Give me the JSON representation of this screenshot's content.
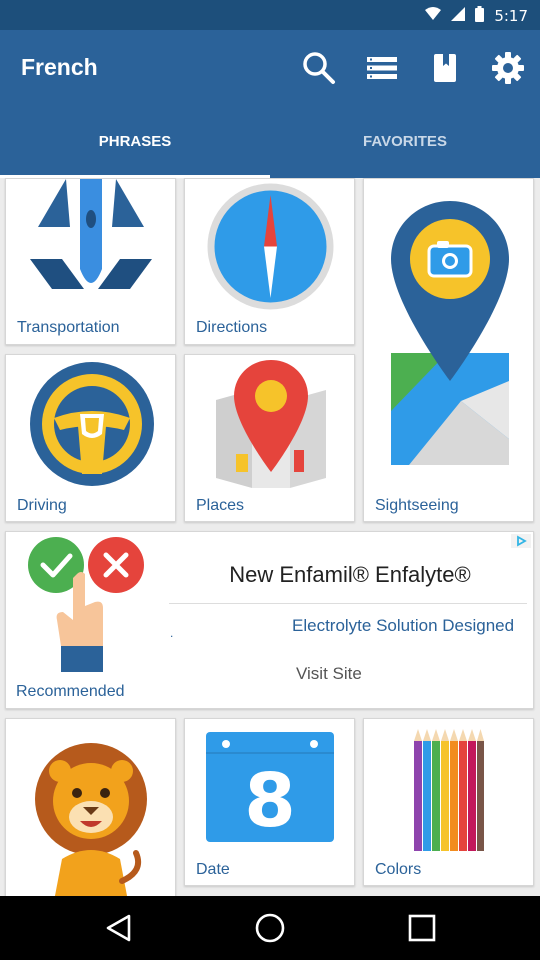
{
  "status_bar": {
    "time": "5:17"
  },
  "app_bar": {
    "title": "French",
    "tabs": [
      {
        "label": "PHRASES"
      },
      {
        "label": "FAVORITES"
      }
    ],
    "active_tab": "PHRASES"
  },
  "categories": [
    {
      "label": "Transportation",
      "icon": "airplane-icon"
    },
    {
      "label": "Directions",
      "icon": "compass-icon"
    },
    {
      "label": "Sightseeing",
      "icon": "map-pin-camera-icon"
    },
    {
      "label": "Driving",
      "icon": "steering-wheel-icon"
    },
    {
      "label": "Places",
      "icon": "map-pin-icon"
    },
    {
      "label": "Date",
      "icon": "calendar-icon",
      "calendar_number": "8"
    },
    {
      "label": "Colors",
      "icon": "pencils-icon"
    }
  ],
  "ad": {
    "headline": "New Enfamil® Enfalyte®",
    "description": "Electrolyte Solution Designed",
    "dot": ".",
    "cta": "Visit Site",
    "recommended_label": "Recommended"
  },
  "colors": {
    "app_bar": "#2b6299",
    "status_bar": "#1d4f7b",
    "accent_label": "#2b6299"
  }
}
